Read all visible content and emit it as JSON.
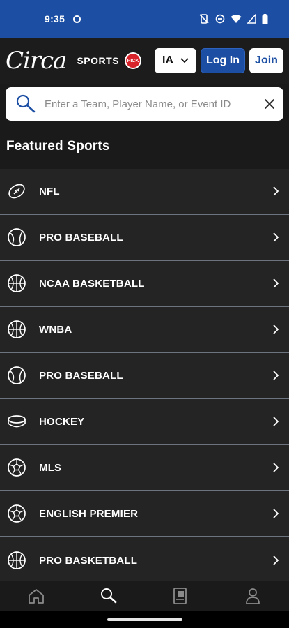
{
  "status_bar": {
    "time": "9:35"
  },
  "header": {
    "logo_text": "Circa",
    "logo_sports": "SPORTS",
    "badge_text": "PICK",
    "state_value": "IA",
    "login_label": "Log In",
    "join_label": "Join"
  },
  "search": {
    "placeholder": "Enter a Team, Player Name, or Event ID"
  },
  "featured": {
    "title": "Featured Sports",
    "items": [
      {
        "label": "NFL",
        "icon": "football-icon"
      },
      {
        "label": "PRO BASEBALL",
        "icon": "baseball-icon"
      },
      {
        "label": "NCAA BASKETBALL",
        "icon": "basketball-icon"
      },
      {
        "label": "WNBA",
        "icon": "basketball-icon"
      },
      {
        "label": "PRO BASEBALL",
        "icon": "baseball-icon"
      },
      {
        "label": "HOCKEY",
        "icon": "hockey-puck-icon"
      },
      {
        "label": "MLS",
        "icon": "soccer-ball-icon"
      },
      {
        "label": "ENGLISH PREMIER",
        "icon": "soccer-ball-icon"
      },
      {
        "label": "PRO BASKETBALL",
        "icon": "basketball-icon"
      }
    ]
  },
  "bottom_nav": [
    "home-icon",
    "search-icon",
    "bet-slip-icon",
    "account-icon"
  ],
  "colors": {
    "brand_blue": "#1c4fa3",
    "background": "#1a1a1a",
    "row": "#242424",
    "divider": "#6d7480"
  }
}
